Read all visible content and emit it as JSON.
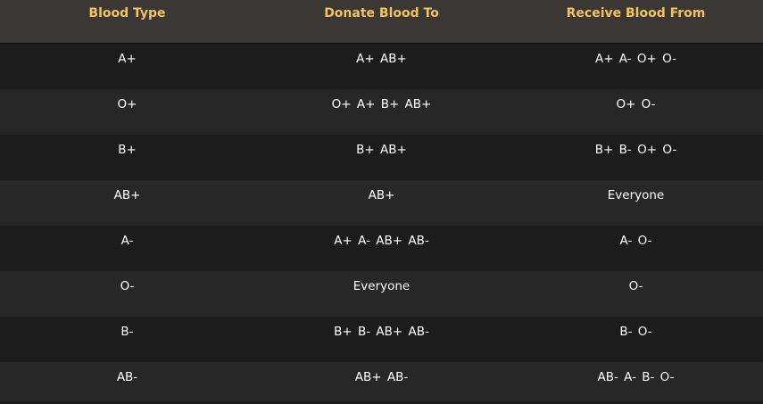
{
  "table": {
    "headers": [
      "Blood Type",
      "Donate Blood To",
      "Receive Blood From"
    ],
    "rows": [
      [
        "A+",
        "A+  AB+",
        "A+  A-  O+  O-"
      ],
      [
        "O+",
        "O+  A+  B+  AB+",
        "O+  O-"
      ],
      [
        "B+",
        "B+  AB+",
        "B+  B-  O+  O-"
      ],
      [
        "AB+",
        "AB+",
        "Everyone"
      ],
      [
        "A-",
        "A+  A-  AB+  AB-",
        "A-  O-"
      ],
      [
        "O-",
        "Everyone",
        "O-"
      ],
      [
        "B-",
        "B+  B-  AB+  AB-",
        "B-  O-"
      ],
      [
        "AB-",
        "AB+  AB-",
        "AB-  A-  B-  O-"
      ]
    ]
  },
  "colors": {
    "header_bg": "#3a3735",
    "header_text": "#f2c35e",
    "row_dark": "#1c1c1c",
    "row_light": "#272727",
    "cell_text": "#ffffff"
  }
}
